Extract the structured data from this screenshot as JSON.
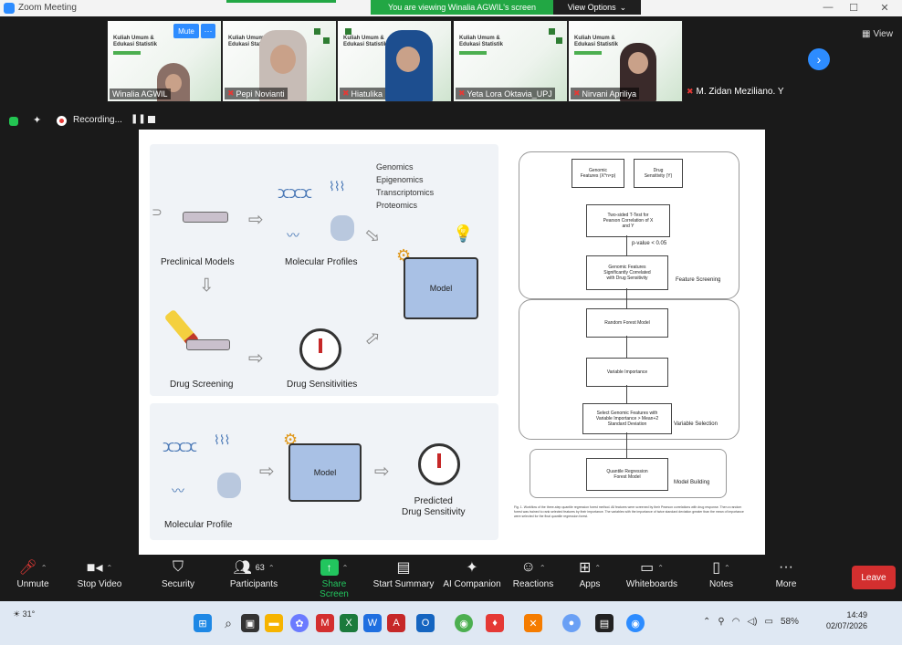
{
  "window": {
    "title": "Zoom Meeting",
    "min": "—",
    "max": "☐",
    "close": "✕"
  },
  "banner": {
    "viewing": "You are viewing Winalia AGWIL's screen",
    "view_options": "View Options",
    "caret": "⌄"
  },
  "gallery": {
    "slide_title": "Kuliah Umum &\nEdukasi Statistik",
    "participants": [
      {
        "name": "Winalia AGWIL",
        "muted": false
      },
      {
        "name": "Pepi Novianti",
        "muted": true
      },
      {
        "name": "Hiatulika",
        "muted": true
      },
      {
        "name": "Yeta Lora Oktavia_UPJ",
        "muted": true
      },
      {
        "name": "Nirvani Apriliya",
        "muted": true
      }
    ],
    "sixth": "M. Zidan Meziliano. Y",
    "mute_badge": "Mute",
    "more_badge": "···",
    "view_label": "View",
    "next_icon": "›"
  },
  "recording": {
    "label": "Recording...",
    "pause": "❚❚"
  },
  "slide": {
    "top": {
      "preclinical": "Preclinical Models",
      "molecular": "Molecular Profiles",
      "omics": [
        "Genomics",
        "Epigenomics",
        "Transcriptomics",
        "Proteomics"
      ],
      "model": "Model",
      "drug_screening": "Drug Screening",
      "drug_sensitivities": "Drug Sensitivities"
    },
    "bottom": {
      "molecular": "Molecular Profile",
      "model": "Model",
      "predicted": "Predicted\nDrug Sensitivity"
    },
    "flow": {
      "genomic": "Genomic\nFeatures (X^n×p)",
      "drug": "Drug\nSensitivity (Y)",
      "ttest": "Two-sided T-Test for\nPearson Correlation of X\nand Y",
      "pval": "p-value < 0.05",
      "sig": "Genomic Features\nSignificantly Correlated\nwith Drug Sensitivity",
      "feature_screening": "Feature Screening",
      "rf": "Random Forest Model",
      "vi": "Variable Importance",
      "select": "Select Genomic Features with\nVariable Importance > Mean+2\nStandard Deviation",
      "variable_selection": "Variable Selection",
      "qrf": "Quantile Regression\nForest Model",
      "model_building": "Model Building",
      "caption": "Fig. 1. Workflow of the three-step quantile regression forest method. All features were screened by their Pearson correlations with drug response. Then a random forest was trained to rank selected features by their importance. The variables with the importance of twice standard deviation greater than the mean of importance were selected for the final quantile regression forest."
    }
  },
  "toolbar": {
    "unmute": "Unmute",
    "stop_video": "Stop Video",
    "security": "Security",
    "participants": "Participants",
    "participants_count": "63",
    "share_screen": "Share Screen",
    "start_summary": "Start Summary",
    "ai_companion": "AI Companion",
    "reactions": "Reactions",
    "apps": "Apps",
    "whiteboards": "Whiteboards",
    "notes": "Notes",
    "more": "More",
    "leave": "Leave"
  },
  "taskbar": {
    "weather": "31°",
    "battery": "58%",
    "time": "14:49",
    "date": "02/07/2026"
  }
}
